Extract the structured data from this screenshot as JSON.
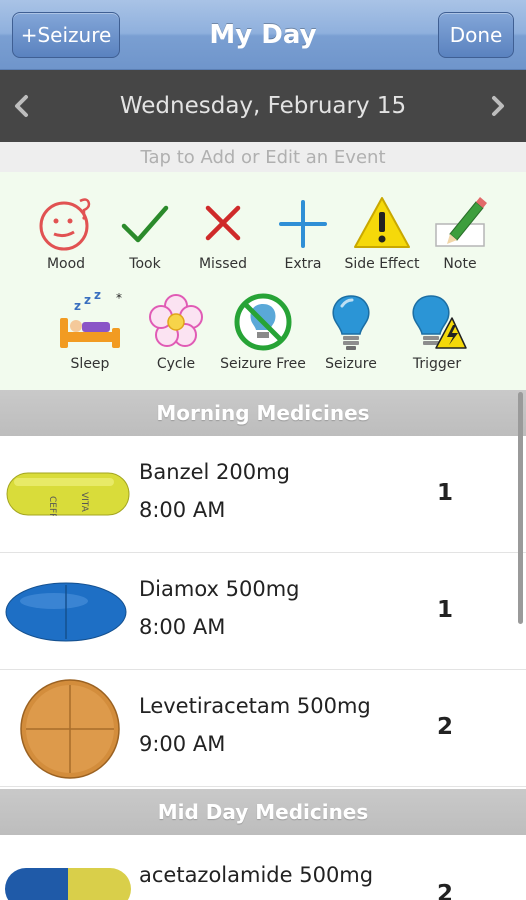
{
  "navbar": {
    "left_button": "+Seizure",
    "title": "My Day",
    "right_button": "Done"
  },
  "datebar": {
    "date": "Wednesday, February 15",
    "prev_icon": "chevron-left-icon",
    "next_icon": "chevron-right-icon"
  },
  "hint": "Tap to Add or Edit an Event",
  "events": {
    "row1": [
      {
        "label": "Mood",
        "icon": "mood-face-icon"
      },
      {
        "label": "Took",
        "icon": "checkmark-icon"
      },
      {
        "label": "Missed",
        "icon": "x-mark-icon"
      },
      {
        "label": "Extra",
        "icon": "plus-icon"
      },
      {
        "label": "Side Effect",
        "icon": "warning-icon"
      },
      {
        "label": "Note",
        "icon": "pencil-note-icon"
      }
    ],
    "row2": [
      {
        "label": "Sleep",
        "icon": "bed-icon"
      },
      {
        "label": "Cycle",
        "icon": "flower-icon"
      },
      {
        "label": "Seizure Free",
        "icon": "no-bulb-icon"
      },
      {
        "label": "Seizure",
        "icon": "lightbulb-icon"
      },
      {
        "label": "Trigger",
        "icon": "bulb-lightning-icon"
      }
    ]
  },
  "sections": [
    {
      "title": "Morning Medicines",
      "meds": [
        {
          "name": "Banzel 200mg",
          "time": "8:00 AM",
          "qty": "1",
          "pill": "yellow-capsule-icon"
        },
        {
          "name": "Diamox 500mg",
          "time": "8:00 AM",
          "qty": "1",
          "pill": "blue-oval-tablet-icon"
        },
        {
          "name": "Levetiracetam 500mg",
          "time": "9:00 AM",
          "qty": "2",
          "pill": "orange-round-tablet-icon"
        }
      ]
    },
    {
      "title": "Mid Day Medicines",
      "meds": [
        {
          "name": "acetazolamide 500mg",
          "time": "",
          "qty": "2",
          "pill": "blue-yellow-capsule-icon"
        }
      ]
    }
  ],
  "colors": {
    "nav_blue": "#7a9fd2",
    "date_bar": "#464646",
    "event_panel": "#f2fbee",
    "section_header": "#c4c4c4"
  }
}
